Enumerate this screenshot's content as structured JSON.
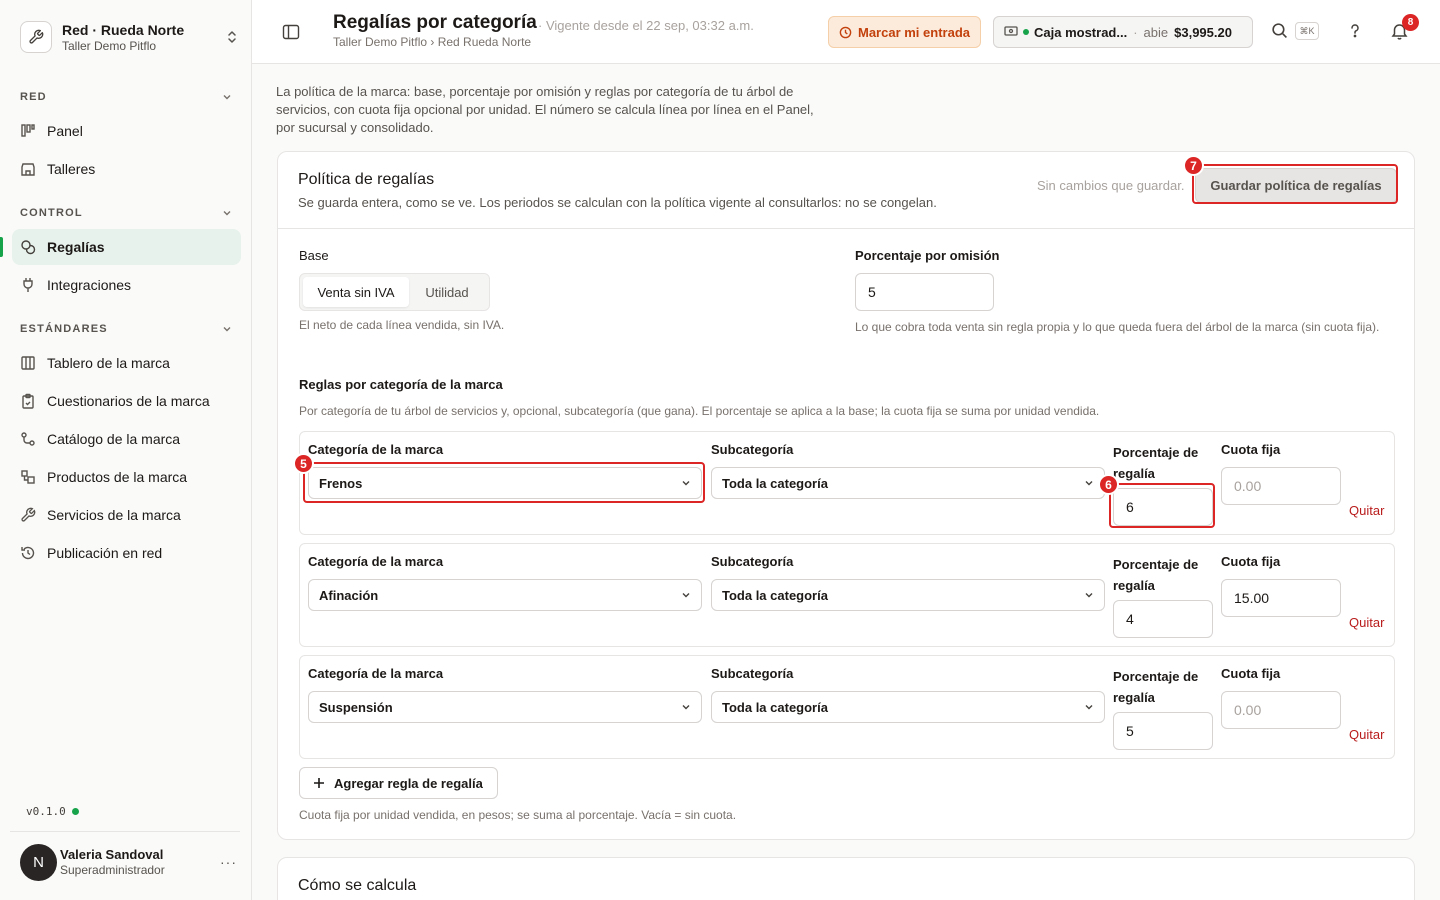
{
  "sidebar": {
    "org_name": "Red · Rueda Norte",
    "org_sub": "Taller Demo Pitflo",
    "sections": [
      {
        "label": "RED",
        "items": [
          {
            "label": "Panel",
            "icon": "kanban-icon"
          },
          {
            "label": "Talleres",
            "icon": "store-icon"
          }
        ]
      },
      {
        "label": "CONTROL",
        "items": [
          {
            "label": "Regalías",
            "icon": "coins-icon"
          },
          {
            "label": "Integraciones",
            "icon": "plug-icon"
          }
        ]
      },
      {
        "label": "ESTÁNDARES",
        "items": [
          {
            "label": "Tablero de la marca",
            "icon": "columns-icon"
          },
          {
            "label": "Cuestionarios de la marca",
            "icon": "clipboard-icon"
          },
          {
            "label": "Catálogo de la marca",
            "icon": "share-icon"
          },
          {
            "label": "Productos de la marca",
            "icon": "boxes-icon"
          },
          {
            "label": "Servicios de la marca",
            "icon": "wrench-icon"
          },
          {
            "label": "Publicación en red",
            "icon": "history-icon"
          }
        ]
      }
    ],
    "active_item": "Regalías",
    "version": "v0.1.0",
    "user": {
      "initial": "N",
      "name": "Valeria Sandoval",
      "role": "Superadministrador"
    }
  },
  "header": {
    "title": "Regalías por categoría",
    "effective": "· Vigente desde el 22 sep, 03:32 a.m.",
    "breadcrumb": "Taller Demo Pitflo › Red Rueda Norte",
    "entry_button": "Marcar mi entrada",
    "till": {
      "name": "Caja mostrad...",
      "status": "abie",
      "amount": "$3,995.20"
    },
    "shortcut": "⌘K",
    "notifications": "8"
  },
  "intro": "La política de la marca: base, porcentaje por omisión y reglas por categoría de tu árbol de servicios, con cuota fija opcional por unidad. El número se calcula línea por línea en el Panel, por sucursal y consolidado.",
  "policy": {
    "title": "Política de regalías",
    "description": "Se guarda entera, como se ve. Los periodos se calculan con la política vigente al consultarlos: no se congelan.",
    "no_changes": "Sin cambios que guardar.",
    "save_button": "Guardar política de regalías",
    "base_label": "Base",
    "base_options": [
      "Venta sin IVA",
      "Utilidad"
    ],
    "base_selected": "Venta sin IVA",
    "base_hint": "El neto de cada línea vendida, sin IVA.",
    "default_label": "Porcentaje por omisión",
    "default_value": "5",
    "default_hint": "Lo que cobra toda venta sin regla propia y lo que queda fuera del árbol de la marca (sin cuota fija).",
    "rules_title": "Reglas por categoría de la marca",
    "rules_desc": "Por categoría de tu árbol de servicios y, opcional, subcategoría (que gana). El porcentaje se aplica a la base; la cuota fija se suma por unidad vendida.",
    "col_category": "Categoría de la marca",
    "col_subcategory": "Subcategoría",
    "col_percent": "Porcentaje de regalía",
    "col_fee": "Cuota fija",
    "fee_placeholder": "0.00",
    "remove": "Quitar",
    "rules": [
      {
        "category": "Frenos",
        "subcategory": "Toda la categoría",
        "percent": "6",
        "fee": ""
      },
      {
        "category": "Afinación",
        "subcategory": "Toda la categoría",
        "percent": "4",
        "fee": "15.00"
      },
      {
        "category": "Suspensión",
        "subcategory": "Toda la categoría",
        "percent": "5",
        "fee": ""
      }
    ],
    "add_rule": "Agregar regla de regalía",
    "fee_hint": "Cuota fija por unidad vendida, en pesos; se suma al porcentaje. Vacía = sin cuota."
  },
  "how_title": "Cómo se calcula",
  "annotations": [
    "5",
    "6",
    "7"
  ],
  "colors": {
    "accent": "#16a34a",
    "danger": "#dc2626",
    "warning_bg": "#fcebdb"
  }
}
